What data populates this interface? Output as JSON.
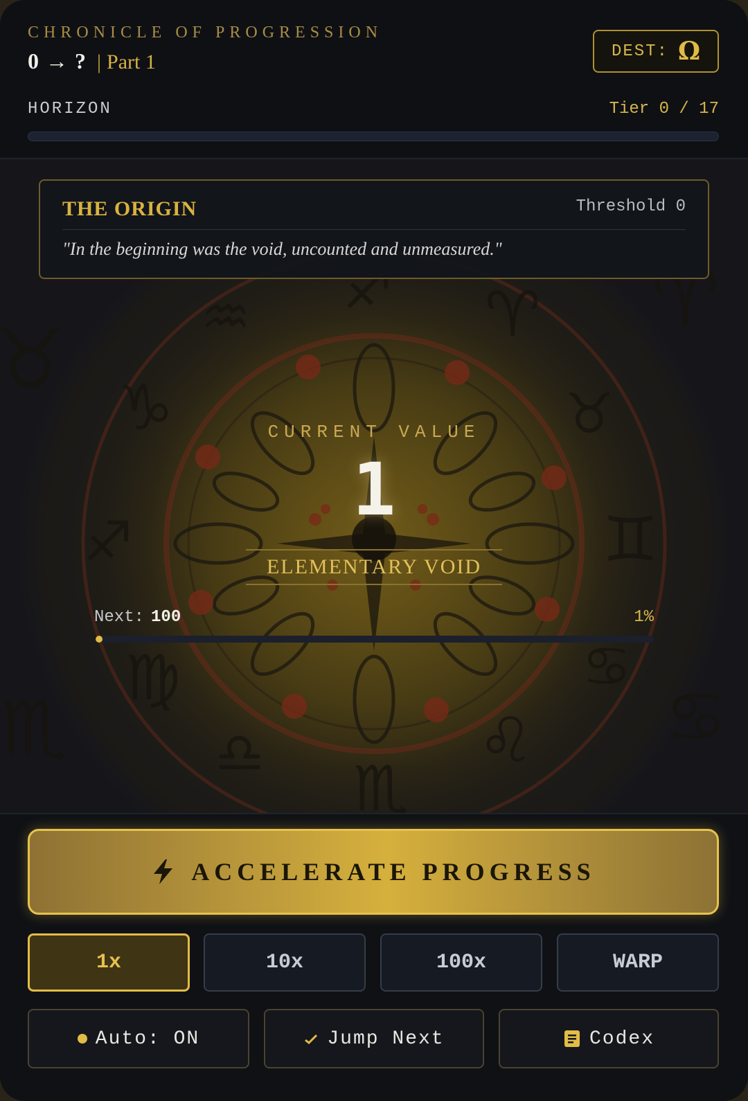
{
  "header": {
    "kicker": "CHRONICLE OF PROGRESSION",
    "start": "0",
    "arrow": "→",
    "target": "?",
    "separator": "|",
    "part": "Part 1",
    "dest_label": "DEST:",
    "dest_symbol": "Ω",
    "horizon_label": "HORIZON",
    "tier": "Tier 0 / 17",
    "horizon_progress": 0
  },
  "origin": {
    "title": "THE ORIGIN",
    "threshold": "Threshold 0",
    "quote": "\"In the beginning was the void, uncounted and unmeasured.\""
  },
  "counter": {
    "label": "CURRENT VALUE",
    "value": "1",
    "name": "ELEMENTARY VOID",
    "next_label": "Next:",
    "next_value": "100",
    "percent": "1%",
    "progress_fraction": 0.01
  },
  "controls": {
    "accelerate_label": "ACCELERATE PROGRESS",
    "accelerate_icon": "lightning-icon",
    "multipliers": [
      {
        "label": "1x",
        "active": true
      },
      {
        "label": "10x",
        "active": false
      },
      {
        "label": "100x",
        "active": false
      },
      {
        "label": "WARP",
        "active": false
      }
    ],
    "auto_label": "Auto: ON",
    "auto_icon": "status-dot-icon",
    "jump_label": "Jump Next",
    "jump_icon": "check-icon",
    "codex_label": "Codex",
    "codex_icon": "book-icon"
  },
  "colors": {
    "accent": "#d7b64a",
    "background": "#0f1115",
    "progress_fill": "#e2bc45"
  }
}
